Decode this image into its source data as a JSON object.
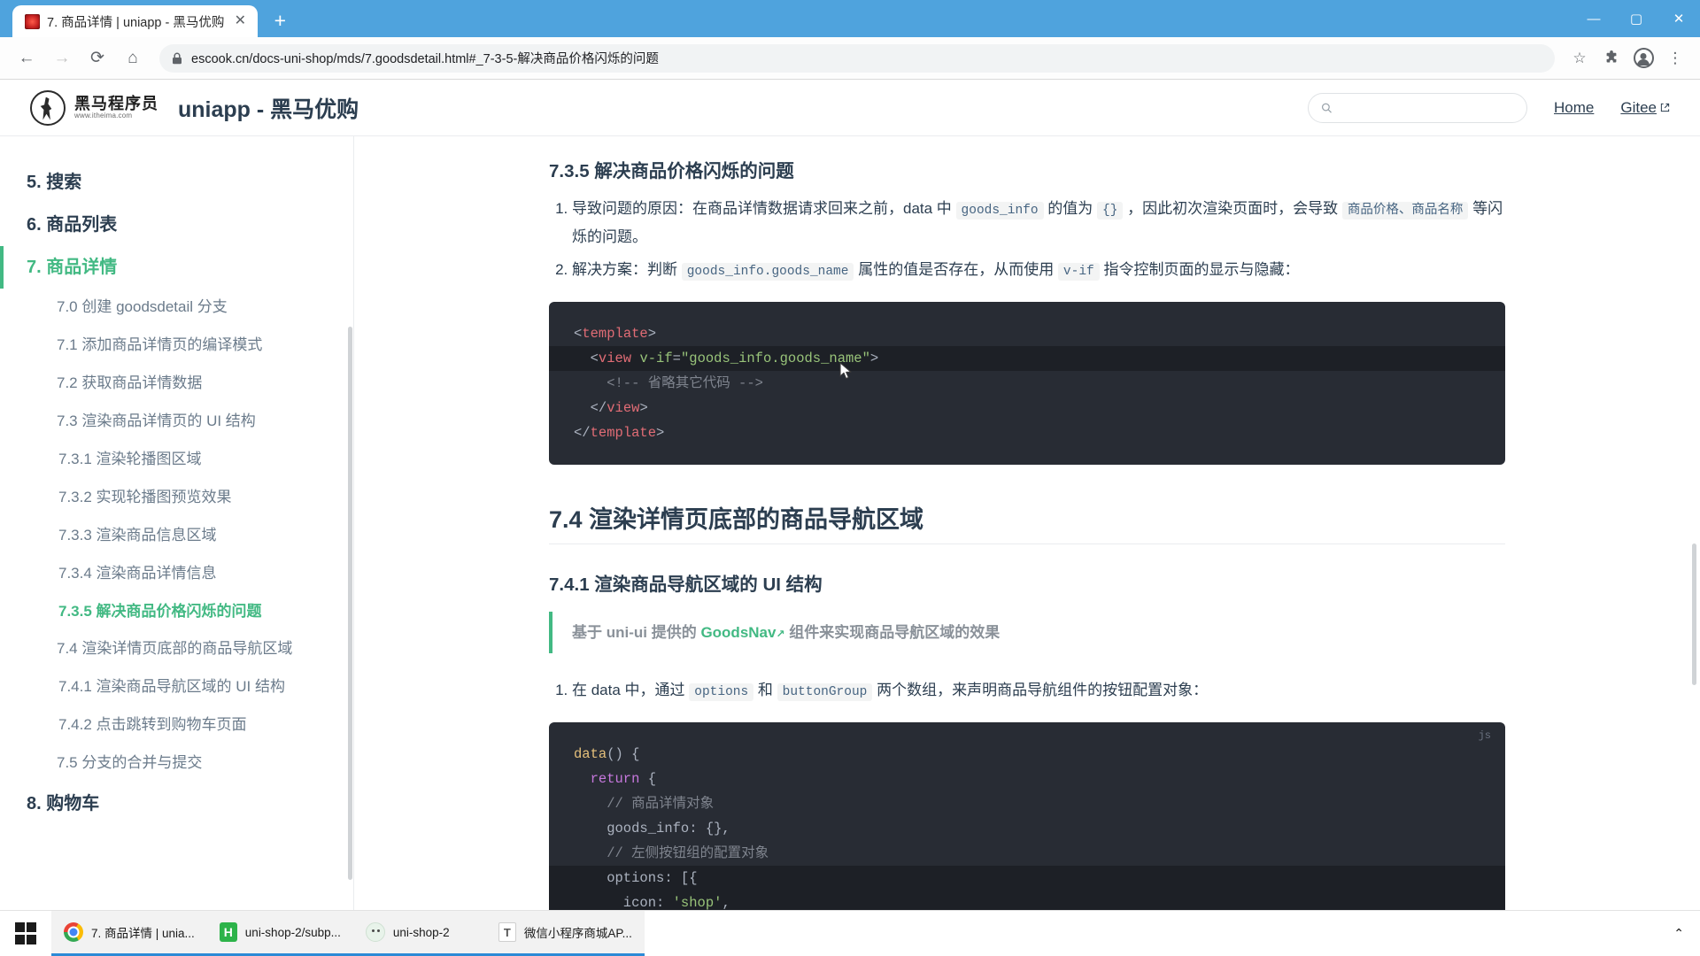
{
  "browser": {
    "tab": {
      "title": "7. 商品详情 | uniapp - 黑马优购",
      "close": "✕"
    },
    "newtab": "+",
    "window": {
      "minimize": "—",
      "maximize": "▢",
      "close": "✕"
    },
    "nav": {
      "back": "←",
      "forward": "→",
      "reload": "⟳",
      "home": "⌂"
    },
    "url": "escook.cn/docs-uni-shop/mds/7.goodsdetail.html#_7-3-5-解决商品价格闪烁的问题",
    "bookmark": "☆",
    "extensions": "🧩",
    "menu": "⋮"
  },
  "site": {
    "logo_cn": "黑马程序员",
    "logo_en": "www.itheima.com",
    "title": "uniapp - 黑马优购",
    "search_placeholder": "",
    "search_value": "",
    "nav": [
      {
        "label": "Home",
        "external": false
      },
      {
        "label": "Gitee",
        "external": true
      }
    ]
  },
  "sidebar": {
    "items": [
      {
        "level": 1,
        "label": "5. 搜索",
        "active": false
      },
      {
        "level": 1,
        "label": "6. 商品列表",
        "active": false
      },
      {
        "level": 1,
        "label": "7. 商品详情",
        "active": true
      },
      {
        "level": 2,
        "label": "7.0 创建 goodsdetail 分支",
        "active": false
      },
      {
        "level": 2,
        "label": "7.1 添加商品详情页的编译模式",
        "active": false
      },
      {
        "level": 2,
        "label": "7.2 获取商品详情数据",
        "active": false
      },
      {
        "level": 2,
        "label": "7.3 渲染商品详情页的 UI 结构",
        "active": false
      },
      {
        "level": 3,
        "label": "7.3.1 渲染轮播图区域",
        "active": false
      },
      {
        "level": 3,
        "label": "7.3.2 实现轮播图预览效果",
        "active": false
      },
      {
        "level": 3,
        "label": "7.3.3 渲染商品信息区域",
        "active": false
      },
      {
        "level": 3,
        "label": "7.3.4 渲染商品详情信息",
        "active": false
      },
      {
        "level": 3,
        "label": "7.3.5 解决商品价格闪烁的问题",
        "active": true
      },
      {
        "level": 2,
        "label": "7.4 渲染详情页底部的商品导航区域",
        "active": false
      },
      {
        "level": 3,
        "label": "7.4.1 渲染商品导航区域的 UI 结构",
        "active": false
      },
      {
        "level": 3,
        "label": "7.4.2 点击跳转到购物车页面",
        "active": false
      },
      {
        "level": 2,
        "label": "7.5 分支的合并与提交",
        "active": false
      },
      {
        "level": 1,
        "label": "8. 购物车",
        "active": false
      }
    ]
  },
  "content": {
    "heading_735": "7.3.5 解决商品价格闪烁的问题",
    "list_735": [
      {
        "parts": [
          {
            "t": "text",
            "v": "导致问题的原因：在商品详情数据请求回来之前，data 中 "
          },
          {
            "t": "code",
            "v": "goods_info"
          },
          {
            "t": "text",
            "v": " 的值为 "
          },
          {
            "t": "code",
            "v": "{}"
          },
          {
            "t": "text",
            "v": " ，因此初次渲染页面时，会导致 "
          },
          {
            "t": "code",
            "v": "商品价格、商品名称"
          },
          {
            "t": "text",
            "v": " 等闪烁的问题。"
          }
        ]
      },
      {
        "parts": [
          {
            "t": "text",
            "v": "解决方案：判断 "
          },
          {
            "t": "code",
            "v": "goods_info.goods_name"
          },
          {
            "t": "text",
            "v": " 属性的值是否存在，从而使用 "
          },
          {
            "t": "code",
            "v": "v-if"
          },
          {
            "t": "text",
            "v": " 指令控制页面的显示与隐藏："
          }
        ]
      }
    ],
    "code_template": {
      "lang": "",
      "lines": [
        {
          "hl": false,
          "tokens": [
            {
              "c": "t-punct",
              "v": "<"
            },
            {
              "c": "t-tag",
              "v": "template"
            },
            {
              "c": "t-punct",
              "v": ">"
            }
          ]
        },
        {
          "hl": true,
          "tokens": [
            {
              "c": "t-punct",
              "v": "  <"
            },
            {
              "c": "t-tag",
              "v": "view"
            },
            {
              "c": "t-punct",
              "v": " "
            },
            {
              "c": "t-attr",
              "v": "v-if"
            },
            {
              "c": "t-punct",
              "v": "="
            },
            {
              "c": "t-str2",
              "v": "\"goods_info.goods_name\""
            },
            {
              "c": "t-punct",
              "v": ">"
            }
          ]
        },
        {
          "hl": false,
          "tokens": [
            {
              "c": "t-cmt",
              "v": "    <!-- 省略其它代码 -->"
            }
          ]
        },
        {
          "hl": false,
          "tokens": [
            {
              "c": "t-punct",
              "v": "  </"
            },
            {
              "c": "t-tag",
              "v": "view"
            },
            {
              "c": "t-punct",
              "v": ">"
            }
          ]
        },
        {
          "hl": false,
          "tokens": [
            {
              "c": "t-punct",
              "v": "</"
            },
            {
              "c": "t-tag",
              "v": "template"
            },
            {
              "c": "t-punct",
              "v": ">"
            }
          ]
        }
      ]
    },
    "heading_74": "7.4 渲染详情页底部的商品导航区域",
    "heading_741": "7.4.1 渲染商品导航区域的 UI 结构",
    "tip": {
      "before": "基于 uni-ui 提供的 ",
      "link": "GoodsNav",
      "link_icon": "↗",
      "after": " 组件来实现商品导航区域的效果"
    },
    "list_741": [
      {
        "parts": [
          {
            "t": "text",
            "v": "在 data 中，通过 "
          },
          {
            "t": "code",
            "v": "options"
          },
          {
            "t": "text",
            "v": " 和 "
          },
          {
            "t": "code",
            "v": "buttonGroup"
          },
          {
            "t": "text",
            "v": " 两个数组，来声明商品导航组件的按钮配置对象："
          }
        ]
      }
    ],
    "code_js": {
      "lang": "js",
      "lines": [
        {
          "hl": false,
          "tokens": [
            {
              "c": "t-fn",
              "v": "data"
            },
            {
              "c": "t-punct",
              "v": "() {"
            }
          ]
        },
        {
          "hl": false,
          "tokens": [
            {
              "c": "t-kw",
              "v": "  return"
            },
            {
              "c": "t-punct",
              "v": " {"
            }
          ]
        },
        {
          "hl": false,
          "tokens": [
            {
              "c": "t-cmt",
              "v": "    // 商品详情对象"
            }
          ]
        },
        {
          "hl": false,
          "tokens": [
            {
              "c": "t-punct",
              "v": "    goods_info: {},"
            }
          ]
        },
        {
          "hl": false,
          "tokens": [
            {
              "c": "t-cmt",
              "v": "    // 左侧按钮组的配置对象"
            }
          ]
        },
        {
          "hl": true,
          "tokens": [
            {
              "c": "t-punct",
              "v": "    options: [{"
            }
          ]
        },
        {
          "hl": true,
          "tokens": [
            {
              "c": "t-punct",
              "v": "      icon: "
            },
            {
              "c": "t-val",
              "v": "'shop'"
            },
            {
              "c": "t-punct",
              "v": ","
            }
          ]
        }
      ]
    }
  },
  "taskbar": {
    "start": "start-button",
    "items": [
      {
        "icon": "chrome-icon",
        "label": "7. 商品详情 | unia...",
        "active": true
      },
      {
        "icon": "hbuilder-icon",
        "label": "uni-shop-2/subp...",
        "active": true
      },
      {
        "icon": "wechat-devtools-icon",
        "label": "uni-shop-2",
        "active": true
      },
      {
        "icon": "typora-icon",
        "label": "微信小程序商城AP...",
        "active": true
      }
    ],
    "tray_caret": "⌃"
  }
}
